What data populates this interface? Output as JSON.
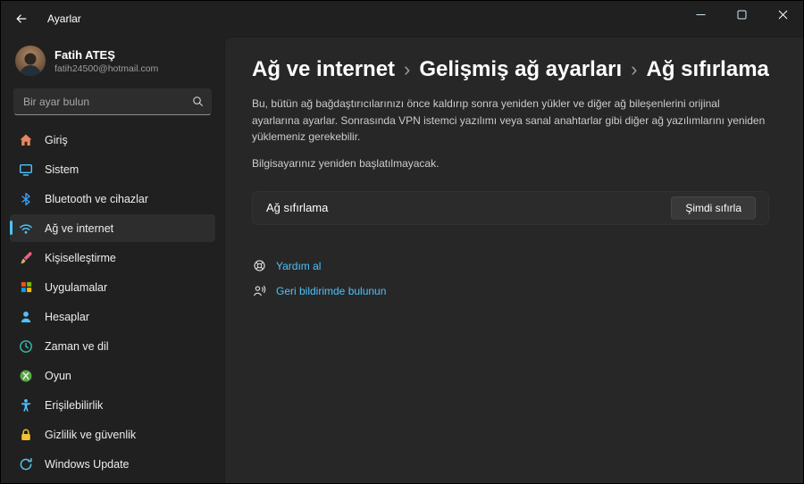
{
  "colors": {
    "accent": "#4cc2ff",
    "link": "#4cc2ff"
  },
  "window": {
    "title": "Ayarlar"
  },
  "user": {
    "name": "Fatih ATEŞ",
    "email": "fatih24500@hotmail.com"
  },
  "search": {
    "placeholder": "Bir ayar bulun"
  },
  "sidebar": {
    "items": [
      {
        "label": "Giriş"
      },
      {
        "label": "Sistem"
      },
      {
        "label": "Bluetooth ve cihazlar"
      },
      {
        "label": "Ağ ve internet",
        "selected": true
      },
      {
        "label": "Kişiselleştirme"
      },
      {
        "label": "Uygulamalar"
      },
      {
        "label": "Hesaplar"
      },
      {
        "label": "Zaman ve dil"
      },
      {
        "label": "Oyun"
      },
      {
        "label": "Erişilebilirlik"
      },
      {
        "label": "Gizlilik ve güvenlik"
      },
      {
        "label": "Windows Update"
      }
    ]
  },
  "main": {
    "breadcrumb": [
      "Ağ ve internet",
      "Gelişmiş ağ ayarları",
      "Ağ sıfırlama"
    ],
    "breadcrumb_separator": "›",
    "description": "Bu, bütün ağ bağdaştırıcılarınızı önce kaldırıp sonra yeniden yükler ve diğer ağ bileşenlerini orijinal ayarlarına ayarlar. Sonrasında VPN istemci yazılımı veya sanal anahtarlar gibi diğer ağ yazılımlarını yeniden yüklemeniz gerekebilir.",
    "note": "Bilgisayarınız yeniden başlatılmayacak.",
    "reset_row": {
      "label": "Ağ sıfırlama",
      "button_label": "Şimdi sıfırla"
    },
    "links": [
      {
        "label": "Yardım al"
      },
      {
        "label": "Geri bildirimde bulunun"
      }
    ]
  }
}
